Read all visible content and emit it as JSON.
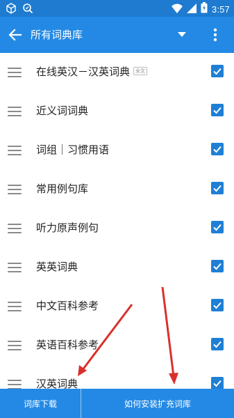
{
  "status_bar": {
    "time": "3:57",
    "icons": [
      "box-icon",
      "search-badge-icon",
      "wifi-icon",
      "signal-icon",
      "battery-icon"
    ]
  },
  "app_bar": {
    "title": "所有词典库",
    "icons": [
      "back-arrow-icon",
      "dropdown-caret-icon",
      "more-vert-icon"
    ]
  },
  "dictionaries": [
    {
      "label": "在线英汉－汉英词典",
      "badge": "全文",
      "checked": true
    },
    {
      "label": "近义词词典",
      "badge": "",
      "checked": true
    },
    {
      "label": "词组｜习惯用语",
      "badge": "",
      "checked": true
    },
    {
      "label": "常用例句库",
      "badge": "",
      "checked": true
    },
    {
      "label": "听力原声例句",
      "badge": "",
      "checked": true
    },
    {
      "label": "英英词典",
      "badge": "",
      "checked": true
    },
    {
      "label": "中文百科参考",
      "badge": "",
      "checked": true
    },
    {
      "label": "英语百科参考",
      "badge": "",
      "checked": true
    },
    {
      "label": "汉英词典",
      "badge": "",
      "checked": true
    }
  ],
  "bottom_bar": {
    "left_label": "词库下载",
    "right_label": "如何安装扩充词库"
  },
  "colors": {
    "status_bar": "#1e7bd0",
    "app_bar": "#2389e4",
    "checkbox": "#1f7fd5",
    "annotation_arrow": "#d9302c"
  }
}
